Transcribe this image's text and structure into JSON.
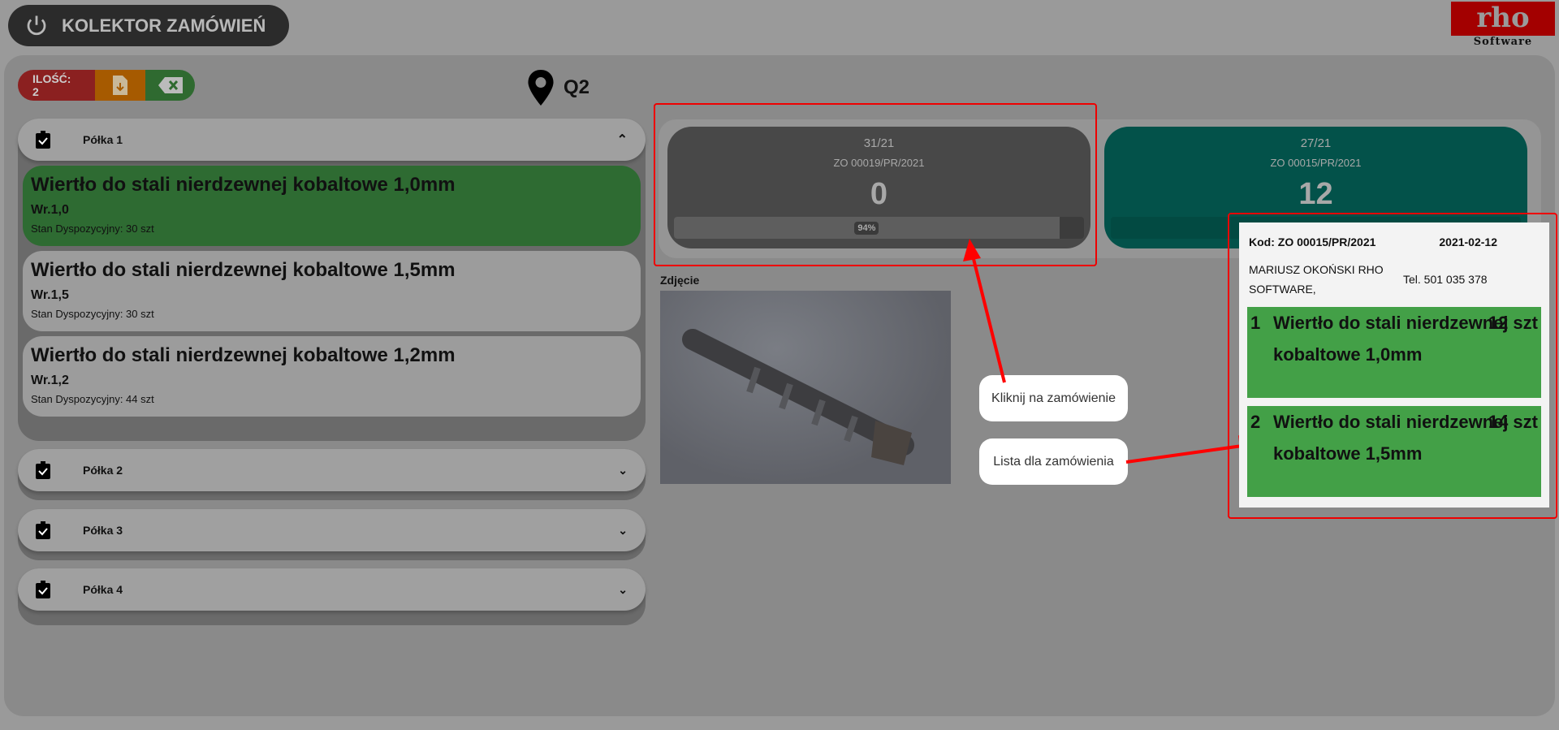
{
  "header": {
    "title": "KOLEKTOR ZAMÓWIEŃ",
    "logo_text": "rho",
    "logo_sub": "Software"
  },
  "actions": {
    "quantity_label": "ILOŚĆ: 2"
  },
  "location": {
    "label": "Q2"
  },
  "shelves": [
    {
      "label": "Półka 1",
      "expanded": true,
      "items": [
        {
          "name": "Wiertło do stali nierdzewnej kobaltowe 1,0mm",
          "code": "Wr.1,0",
          "stock": "Stan Dyspozycyjny: 30 szt",
          "selected": true
        },
        {
          "name": "Wiertło do stali nierdzewnej kobaltowe 1,5mm",
          "code": "Wr.1,5",
          "stock": "Stan Dyspozycyjny: 30 szt"
        },
        {
          "name": "Wiertło do stali nierdzewnej kobaltowe 1,2mm",
          "code": "Wr.1,2",
          "stock": "Stan Dyspozycyjny: 44 szt"
        }
      ]
    },
    {
      "label": "Półka 2"
    },
    {
      "label": "Półka 3"
    },
    {
      "label": "Półka 4"
    }
  ],
  "orders": [
    {
      "num": "31/21",
      "code": "ZO 00019/PR/2021",
      "value": "0",
      "progress_label": "94%",
      "progress": 94
    },
    {
      "num": "27/21",
      "code": "ZO 00015/PR/2021",
      "value": "12"
    }
  ],
  "photo_label": "Zdjęcie",
  "callouts": {
    "click": "Kliknij na zamówienie",
    "list": "Lista dla zamówienia"
  },
  "popup": {
    "code": "Kod: ZO 00015/PR/2021",
    "date": "2021-02-12",
    "customer": "MARIUSZ OKOŃSKI RHO SOFTWARE,",
    "phone": "Tel. 501 035 378",
    "items": [
      {
        "no": "1",
        "name": "Wiertło do stali nierdzewnej kobaltowe 1,0mm",
        "qty": "12 szt"
      },
      {
        "no": "2",
        "name": "Wiertło do stali nierdzewnej kobaltowe 1,5mm",
        "qty": "14 szt"
      }
    ]
  }
}
